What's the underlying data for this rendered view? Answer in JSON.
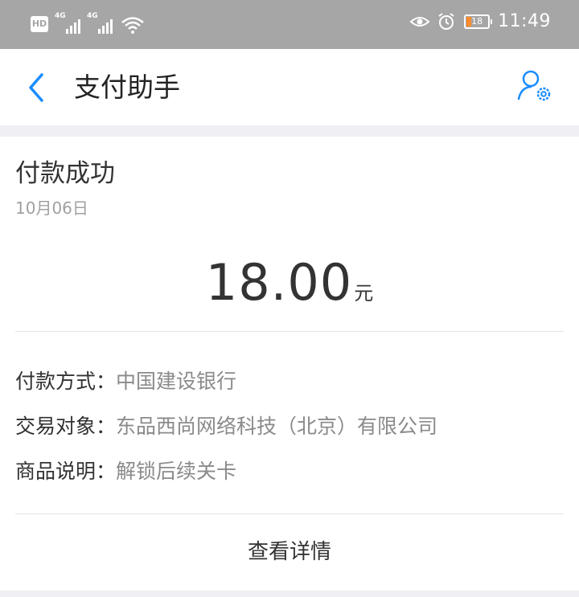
{
  "status_bar": {
    "hd_label": "HD",
    "network_1": "4G",
    "network_2": "4G",
    "battery_level": "18",
    "time": "11:49"
  },
  "nav": {
    "title": "支付助手",
    "back_icon": "chevron-left-icon",
    "settings_icon": "user-settings-icon",
    "accent_color": "#1a8cff"
  },
  "payment": {
    "title": "付款成功",
    "date": "10月06日",
    "amount": "18.00",
    "unit": "元",
    "details": [
      {
        "label": "付款方式：",
        "value": "中国建设银行"
      },
      {
        "label": "交易对象：",
        "value": "东品西尚网络科技（北京）有限公司"
      },
      {
        "label": "商品说明：",
        "value": "解锁后续关卡"
      }
    ],
    "view_details_label": "查看详情"
  }
}
